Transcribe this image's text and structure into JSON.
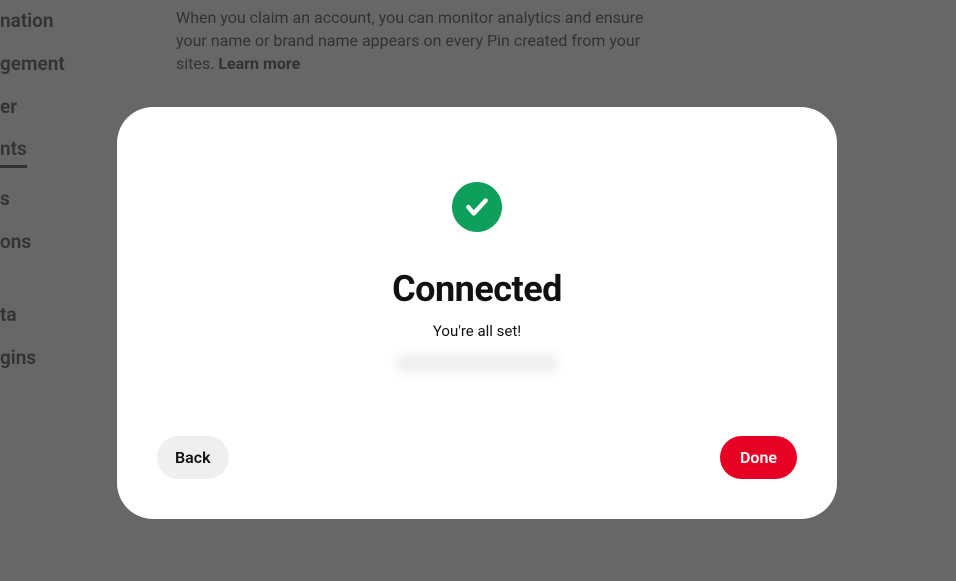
{
  "sidebar": {
    "items": [
      {
        "label": "nation",
        "active": false
      },
      {
        "label": "gement",
        "active": false
      },
      {
        "label": "er",
        "active": false
      },
      {
        "label": "nts",
        "active": true
      },
      {
        "label": "s",
        "active": false
      },
      {
        "label": "ons",
        "active": false
      }
    ],
    "items2": [
      {
        "label": "ta"
      },
      {
        "label": "gins"
      }
    ]
  },
  "main": {
    "description": "When you claim an account, you can monitor analytics and ensure your name or brand name appears on every Pin created from your sites. ",
    "learn_more": "Learn more"
  },
  "modal": {
    "title": "Connected",
    "subtitle": "You're all set!",
    "back_label": "Back",
    "done_label": "Done"
  }
}
